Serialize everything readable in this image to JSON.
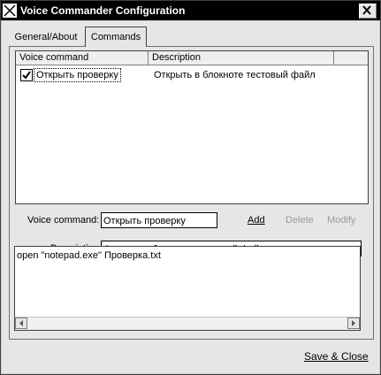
{
  "window": {
    "title": "Voice Commander Configuration"
  },
  "tabs": [
    {
      "label": "General/About"
    },
    {
      "label": "Commands"
    }
  ],
  "list": {
    "columns": [
      "Voice command",
      "Description"
    ],
    "rows": [
      {
        "checked": true,
        "command": "Открыть проверку",
        "description": "Открыть в блокноте тестовый файл"
      }
    ]
  },
  "form": {
    "voice_command_label": "Voice command:",
    "voice_command_value": "Открыть проверку",
    "add_label": "Add",
    "delete_label": "Delete",
    "modify_label": "Modify",
    "description_label": "Description",
    "description_value": "Открыть в блокноте тестовый файл",
    "action_text": "open \"notepad.exe\" Проверка.txt"
  },
  "footer": {
    "save_close_label": "Save & Close"
  }
}
